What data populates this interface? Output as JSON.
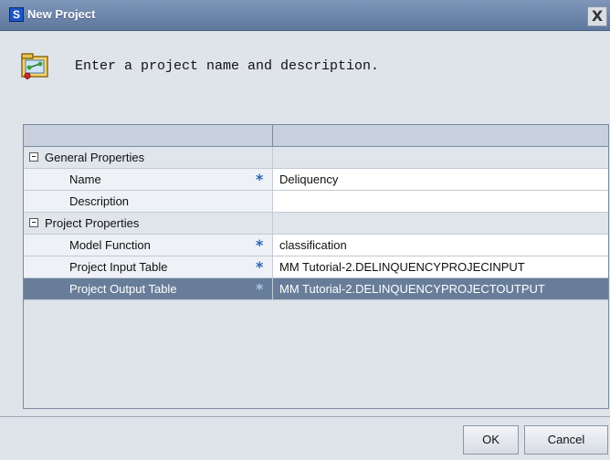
{
  "window": {
    "title": "New Project",
    "app_icon_letter": "S",
    "close_glyph": "X"
  },
  "header": {
    "icon": "project-wizard-icon",
    "instruction": "Enter a project name and description."
  },
  "grid": {
    "required_marker": "*",
    "rows": [
      {
        "type": "category",
        "label": "General Properties",
        "value": ""
      },
      {
        "type": "property",
        "label": "Name",
        "required": true,
        "value": "Deliquency"
      },
      {
        "type": "property",
        "label": "Description",
        "required": false,
        "value": ""
      },
      {
        "type": "category",
        "label": "Project Properties",
        "value": ""
      },
      {
        "type": "property",
        "label": "Model Function",
        "required": true,
        "value": "classification"
      },
      {
        "type": "property",
        "label": "Project Input Table",
        "required": true,
        "value": "MM Tutorial-2.DELINQUENCYPROJECINPUT"
      },
      {
        "type": "property",
        "label": "Project Output Table",
        "required": true,
        "value": "MM Tutorial-2.DELINQUENCYPROJECTOUTPUT",
        "selected": true
      }
    ]
  },
  "footer": {
    "ok_label": "OK",
    "cancel_label": "Cancel"
  },
  "colors": {
    "titlebar": "#6d86aa",
    "selected_row": "#687d99",
    "required_marker": "#2c64b6",
    "dialog_bg": "#dfe4ea"
  }
}
